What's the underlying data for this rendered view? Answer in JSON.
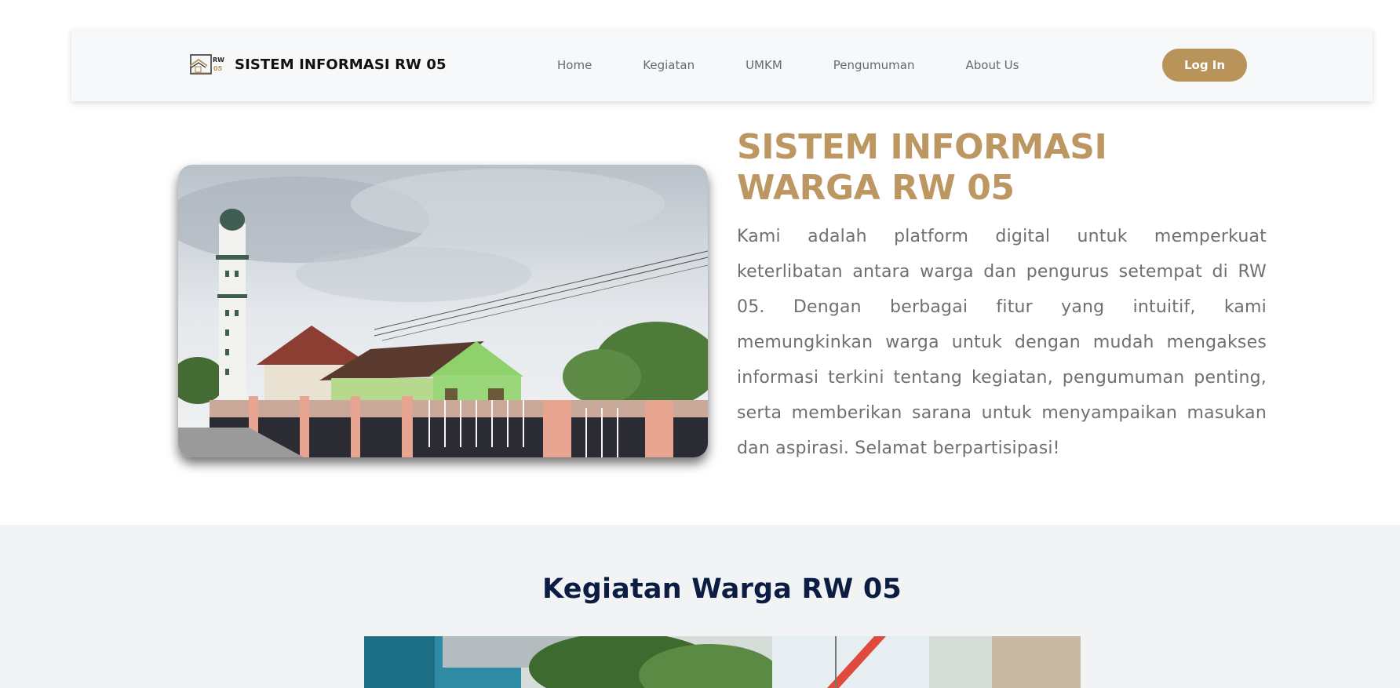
{
  "navbar": {
    "brand": "SISTEM INFORMASI RW 05",
    "logo_text_top": "RW",
    "logo_text_bottom": "05",
    "links": [
      {
        "label": "Home"
      },
      {
        "label": "Kegiatan"
      },
      {
        "label": "UMKM"
      },
      {
        "label": "Pengumuman"
      },
      {
        "label": "About Us"
      }
    ],
    "login_label": "Log In"
  },
  "hero": {
    "title_line1": "SISTEM INFORMASI",
    "title_line2": "WARGA RW 05",
    "description": "Kami adalah platform digital untuk memperkuat keterlibatan antara warga dan pengurus setempat di RW 05. Dengan berbagai fitur yang intuitif, kami memungkinkan warga untuk dengan mudah mengakses informasi terkini tentang kegiatan, pengumuman penting, serta memberikan sarana untuk menyampaikan masukan dan aspirasi. Selamat berpartisipasi!"
  },
  "activities": {
    "title": "Kegiatan Warga RW 05"
  },
  "colors": {
    "accent": "#b8935a",
    "heading_gold": "#bd9761",
    "navy": "#0c1d44",
    "navbar_bg": "#f7f8fa",
    "section_bg": "#f2f3f5"
  },
  "icons": {
    "logo": "house-roof-logo-icon"
  }
}
